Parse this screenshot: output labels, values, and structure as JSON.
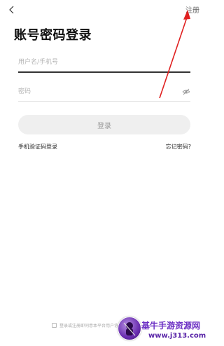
{
  "header": {
    "back_icon": "chevron-left-icon",
    "register_label": "注册"
  },
  "page_title": "账号密码登录",
  "form": {
    "username_placeholder": "用户名/手机号",
    "username_value": "",
    "password_placeholder": "密码",
    "password_value": "",
    "password_toggle_icon": "eye-off-icon"
  },
  "login_button_label": "登录",
  "links": {
    "sms_login": "手机验证码登录",
    "forgot_password": "忘记密码?"
  },
  "agreement_text": "登录或注册即同意本平台用户协议",
  "watermark": {
    "title": "基牛手游资源网",
    "url": "www.j313.com"
  },
  "colors": {
    "annotation_arrow": "#e02020",
    "button_bg": "#efefef",
    "watermark": "#6b2fc4"
  }
}
